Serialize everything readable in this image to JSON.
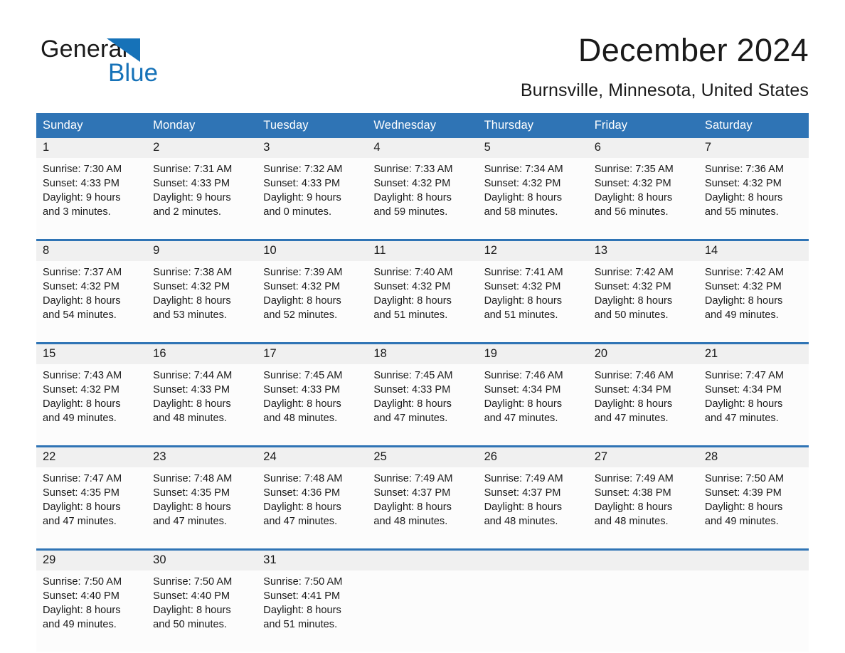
{
  "brand": {
    "name_part1": "General",
    "name_part2": "Blue",
    "accent_color": "#1672b8",
    "triangle_icon": "triangle-icon"
  },
  "header": {
    "title": "December 2024",
    "location": "Burnsville, Minnesota, United States"
  },
  "theme": {
    "header_blue": "#2f74b5",
    "row_band_gray": "#f0f0f0",
    "cell_background": "#fcfcfc",
    "text_color": "#1a1a1a"
  },
  "weekday_headers": [
    "Sunday",
    "Monday",
    "Tuesday",
    "Wednesday",
    "Thursday",
    "Friday",
    "Saturday"
  ],
  "weeks": [
    {
      "days": [
        {
          "num": "1",
          "sunrise": "Sunrise: 7:30 AM",
          "sunset": "Sunset: 4:33 PM",
          "daylight_1": "Daylight: 9 hours",
          "daylight_2": "and 3 minutes."
        },
        {
          "num": "2",
          "sunrise": "Sunrise: 7:31 AM",
          "sunset": "Sunset: 4:33 PM",
          "daylight_1": "Daylight: 9 hours",
          "daylight_2": "and 2 minutes."
        },
        {
          "num": "3",
          "sunrise": "Sunrise: 7:32 AM",
          "sunset": "Sunset: 4:33 PM",
          "daylight_1": "Daylight: 9 hours",
          "daylight_2": "and 0 minutes."
        },
        {
          "num": "4",
          "sunrise": "Sunrise: 7:33 AM",
          "sunset": "Sunset: 4:32 PM",
          "daylight_1": "Daylight: 8 hours",
          "daylight_2": "and 59 minutes."
        },
        {
          "num": "5",
          "sunrise": "Sunrise: 7:34 AM",
          "sunset": "Sunset: 4:32 PM",
          "daylight_1": "Daylight: 8 hours",
          "daylight_2": "and 58 minutes."
        },
        {
          "num": "6",
          "sunrise": "Sunrise: 7:35 AM",
          "sunset": "Sunset: 4:32 PM",
          "daylight_1": "Daylight: 8 hours",
          "daylight_2": "and 56 minutes."
        },
        {
          "num": "7",
          "sunrise": "Sunrise: 7:36 AM",
          "sunset": "Sunset: 4:32 PM",
          "daylight_1": "Daylight: 8 hours",
          "daylight_2": "and 55 minutes."
        }
      ]
    },
    {
      "days": [
        {
          "num": "8",
          "sunrise": "Sunrise: 7:37 AM",
          "sunset": "Sunset: 4:32 PM",
          "daylight_1": "Daylight: 8 hours",
          "daylight_2": "and 54 minutes."
        },
        {
          "num": "9",
          "sunrise": "Sunrise: 7:38 AM",
          "sunset": "Sunset: 4:32 PM",
          "daylight_1": "Daylight: 8 hours",
          "daylight_2": "and 53 minutes."
        },
        {
          "num": "10",
          "sunrise": "Sunrise: 7:39 AM",
          "sunset": "Sunset: 4:32 PM",
          "daylight_1": "Daylight: 8 hours",
          "daylight_2": "and 52 minutes."
        },
        {
          "num": "11",
          "sunrise": "Sunrise: 7:40 AM",
          "sunset": "Sunset: 4:32 PM",
          "daylight_1": "Daylight: 8 hours",
          "daylight_2": "and 51 minutes."
        },
        {
          "num": "12",
          "sunrise": "Sunrise: 7:41 AM",
          "sunset": "Sunset: 4:32 PM",
          "daylight_1": "Daylight: 8 hours",
          "daylight_2": "and 51 minutes."
        },
        {
          "num": "13",
          "sunrise": "Sunrise: 7:42 AM",
          "sunset": "Sunset: 4:32 PM",
          "daylight_1": "Daylight: 8 hours",
          "daylight_2": "and 50 minutes."
        },
        {
          "num": "14",
          "sunrise": "Sunrise: 7:42 AM",
          "sunset": "Sunset: 4:32 PM",
          "daylight_1": "Daylight: 8 hours",
          "daylight_2": "and 49 minutes."
        }
      ]
    },
    {
      "days": [
        {
          "num": "15",
          "sunrise": "Sunrise: 7:43 AM",
          "sunset": "Sunset: 4:32 PM",
          "daylight_1": "Daylight: 8 hours",
          "daylight_2": "and 49 minutes."
        },
        {
          "num": "16",
          "sunrise": "Sunrise: 7:44 AM",
          "sunset": "Sunset: 4:33 PM",
          "daylight_1": "Daylight: 8 hours",
          "daylight_2": "and 48 minutes."
        },
        {
          "num": "17",
          "sunrise": "Sunrise: 7:45 AM",
          "sunset": "Sunset: 4:33 PM",
          "daylight_1": "Daylight: 8 hours",
          "daylight_2": "and 48 minutes."
        },
        {
          "num": "18",
          "sunrise": "Sunrise: 7:45 AM",
          "sunset": "Sunset: 4:33 PM",
          "daylight_1": "Daylight: 8 hours",
          "daylight_2": "and 47 minutes."
        },
        {
          "num": "19",
          "sunrise": "Sunrise: 7:46 AM",
          "sunset": "Sunset: 4:34 PM",
          "daylight_1": "Daylight: 8 hours",
          "daylight_2": "and 47 minutes."
        },
        {
          "num": "20",
          "sunrise": "Sunrise: 7:46 AM",
          "sunset": "Sunset: 4:34 PM",
          "daylight_1": "Daylight: 8 hours",
          "daylight_2": "and 47 minutes."
        },
        {
          "num": "21",
          "sunrise": "Sunrise: 7:47 AM",
          "sunset": "Sunset: 4:34 PM",
          "daylight_1": "Daylight: 8 hours",
          "daylight_2": "and 47 minutes."
        }
      ]
    },
    {
      "days": [
        {
          "num": "22",
          "sunrise": "Sunrise: 7:47 AM",
          "sunset": "Sunset: 4:35 PM",
          "daylight_1": "Daylight: 8 hours",
          "daylight_2": "and 47 minutes."
        },
        {
          "num": "23",
          "sunrise": "Sunrise: 7:48 AM",
          "sunset": "Sunset: 4:35 PM",
          "daylight_1": "Daylight: 8 hours",
          "daylight_2": "and 47 minutes."
        },
        {
          "num": "24",
          "sunrise": "Sunrise: 7:48 AM",
          "sunset": "Sunset: 4:36 PM",
          "daylight_1": "Daylight: 8 hours",
          "daylight_2": "and 47 minutes."
        },
        {
          "num": "25",
          "sunrise": "Sunrise: 7:49 AM",
          "sunset": "Sunset: 4:37 PM",
          "daylight_1": "Daylight: 8 hours",
          "daylight_2": "and 48 minutes."
        },
        {
          "num": "26",
          "sunrise": "Sunrise: 7:49 AM",
          "sunset": "Sunset: 4:37 PM",
          "daylight_1": "Daylight: 8 hours",
          "daylight_2": "and 48 minutes."
        },
        {
          "num": "27",
          "sunrise": "Sunrise: 7:49 AM",
          "sunset": "Sunset: 4:38 PM",
          "daylight_1": "Daylight: 8 hours",
          "daylight_2": "and 48 minutes."
        },
        {
          "num": "28",
          "sunrise": "Sunrise: 7:50 AM",
          "sunset": "Sunset: 4:39 PM",
          "daylight_1": "Daylight: 8 hours",
          "daylight_2": "and 49 minutes."
        }
      ]
    },
    {
      "days": [
        {
          "num": "29",
          "sunrise": "Sunrise: 7:50 AM",
          "sunset": "Sunset: 4:40 PM",
          "daylight_1": "Daylight: 8 hours",
          "daylight_2": "and 49 minutes."
        },
        {
          "num": "30",
          "sunrise": "Sunrise: 7:50 AM",
          "sunset": "Sunset: 4:40 PM",
          "daylight_1": "Daylight: 8 hours",
          "daylight_2": "and 50 minutes."
        },
        {
          "num": "31",
          "sunrise": "Sunrise: 7:50 AM",
          "sunset": "Sunset: 4:41 PM",
          "daylight_1": "Daylight: 8 hours",
          "daylight_2": "and 51 minutes."
        },
        {
          "num": "",
          "sunrise": "",
          "sunset": "",
          "daylight_1": "",
          "daylight_2": ""
        },
        {
          "num": "",
          "sunrise": "",
          "sunset": "",
          "daylight_1": "",
          "daylight_2": ""
        },
        {
          "num": "",
          "sunrise": "",
          "sunset": "",
          "daylight_1": "",
          "daylight_2": ""
        },
        {
          "num": "",
          "sunrise": "",
          "sunset": "",
          "daylight_1": "",
          "daylight_2": ""
        }
      ]
    }
  ]
}
